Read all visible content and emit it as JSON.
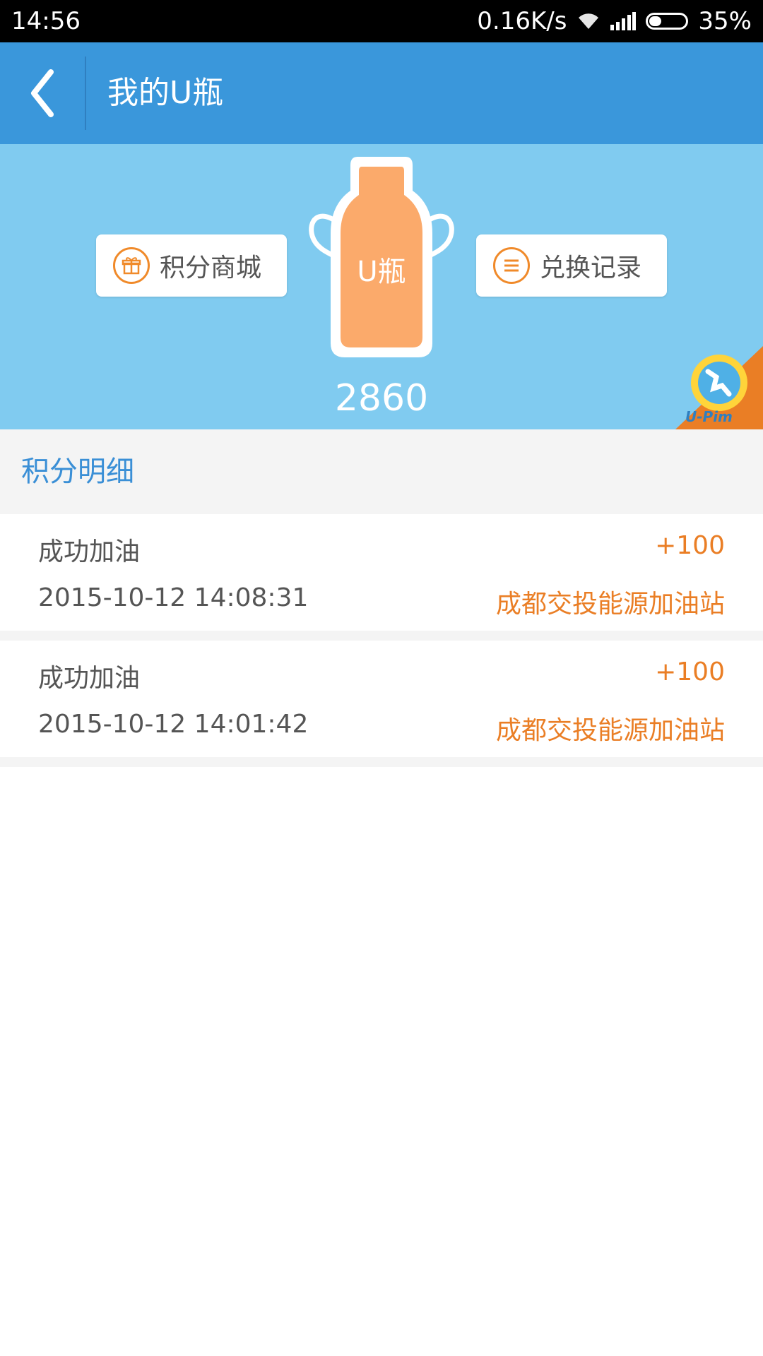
{
  "status_bar": {
    "time": "14:56",
    "net_speed": "0.16K/s",
    "battery": "35%"
  },
  "app_bar": {
    "title": "我的U瓶"
  },
  "hero": {
    "mall_label": "积分商城",
    "records_label": "兑换记录",
    "bottle_text": "U瓶",
    "points": "2860",
    "logo_text": "U-Pim"
  },
  "section": {
    "title": "积分明细"
  },
  "records": [
    {
      "title": "成功加油",
      "points": "+100",
      "time": "2015-10-12 14:08:31",
      "place": "成都交投能源加油站"
    },
    {
      "title": "成功加油",
      "points": "+100",
      "time": "2015-10-12 14:01:42",
      "place": "成都交投能源加油站"
    }
  ],
  "colors": {
    "primary": "#3a97db",
    "hero_bg": "#80cbf0",
    "accent": "#ea7e25",
    "bottle": "#fbaa6b"
  }
}
